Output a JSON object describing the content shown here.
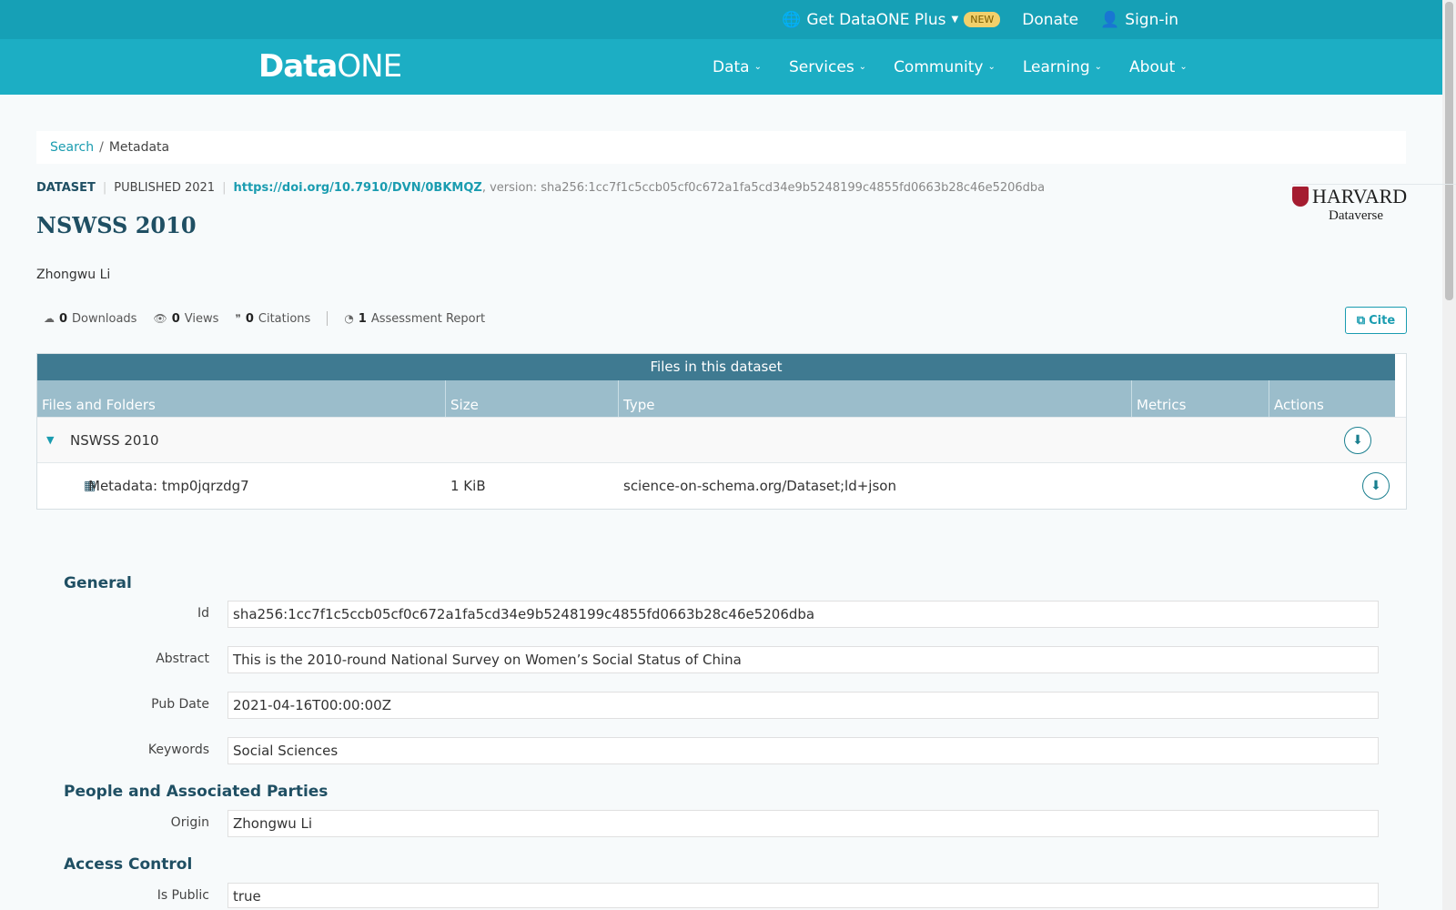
{
  "topbar": {
    "plus_label": "Get DataONE Plus",
    "new_badge": "NEW",
    "donate_label": "Donate",
    "signin_label": "Sign-in"
  },
  "logo": {
    "part1": "Data",
    "part2": "ONE"
  },
  "nav": {
    "items": [
      "Data",
      "Services",
      "Community",
      "Learning",
      "About"
    ]
  },
  "breadcrumb": {
    "search": "Search",
    "separator": "/",
    "current": "Metadata"
  },
  "dataset": {
    "type_label": "DATASET",
    "published": "PUBLISHED 2021",
    "doi": "https://doi.org/10.7910/DVN/0BKMQZ",
    "version": ", version: sha256:1cc7f1c5ccb05cf0c672a1fa5cd34e9b5248199c4855fd0663b28c46e5206dba",
    "title": "NSWSS 2010",
    "author": "Zhongwu Li"
  },
  "repository": {
    "name": "HARVARD",
    "sub": "Dataverse"
  },
  "metrics": {
    "downloads_count": "0",
    "downloads_label": "Downloads",
    "views_count": "0",
    "views_label": "Views",
    "citations_count": "0",
    "citations_label": "Citations",
    "assessment_count": "1",
    "assessment_label": "Assessment Report"
  },
  "cite_label": "Cite",
  "files": {
    "title": "Files in this dataset",
    "headers": [
      "Files and Folders",
      "Size",
      "Type",
      "Metrics",
      "Actions"
    ],
    "folder_name": "NSWSS 2010",
    "file": {
      "name": "Metadata: tmp0jqrzdg7",
      "size": "1 KiB",
      "type": "science-on-schema.org/Dataset;ld+json"
    }
  },
  "general": {
    "title": "General",
    "id_label": "Id",
    "id_value": "sha256:1cc7f1c5ccb05cf0c672a1fa5cd34e9b5248199c4855fd0663b28c46e5206dba",
    "abstract_label": "Abstract",
    "abstract_value": "This is the 2010-round National Survey on Women’s Social Status of China",
    "pubdate_label": "Pub Date",
    "pubdate_value": "2021-04-16T00:00:00Z",
    "keywords_label": "Keywords",
    "keywords_value": "Social Sciences"
  },
  "people": {
    "title": "People and Associated Parties",
    "origin_label": "Origin",
    "origin_value": "Zhongwu Li"
  },
  "access": {
    "title": "Access Control",
    "public_label": "Is Public",
    "public_value": "true"
  }
}
